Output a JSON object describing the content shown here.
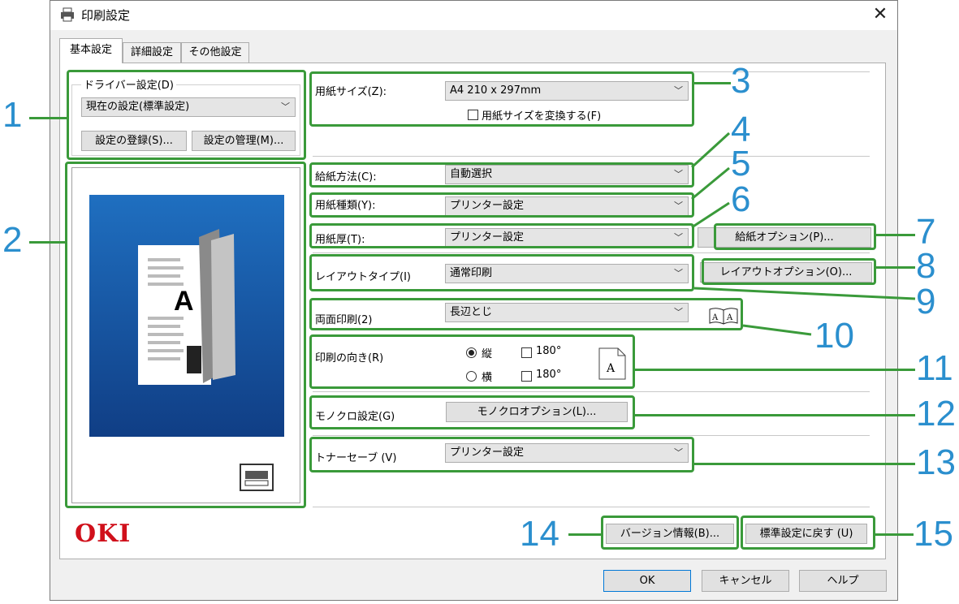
{
  "window": {
    "title": "印刷設定",
    "close_glyph": "✕"
  },
  "tabs": [
    {
      "label": "基本設定",
      "active": true
    },
    {
      "label": "詳細設定",
      "active": false
    },
    {
      "label": "その他設定",
      "active": false
    }
  ],
  "driver_settings": {
    "group_label": "ドライバー設定(D)",
    "current_value": "現在の設定(標準設定)",
    "register_button": "設定の登録(S)...",
    "manage_button": "設定の管理(M)..."
  },
  "paper_size": {
    "label": "用紙サイズ(Z):",
    "value": "A4 210 x 297mm",
    "convert_checkbox": "用紙サイズを変換する(F)",
    "convert_checked": false
  },
  "paper_source": {
    "label": "給紙方法(C):",
    "value": "自動選択"
  },
  "media_type": {
    "label": "用紙種類(Y):",
    "value": "プリンター設定"
  },
  "media_weight": {
    "label": "用紙厚(T):",
    "value": "プリンター設定"
  },
  "feed_options_button": "給紙オプション(P)...",
  "layout": {
    "label": "レイアウトタイプ(I)",
    "value": "通常印刷",
    "options_button": "レイアウトオプション(O)..."
  },
  "duplex": {
    "label": "両面印刷(2)",
    "value": "長辺とじ"
  },
  "orientation": {
    "label": "印刷の向き(R)",
    "portrait": "縦",
    "landscape": "横",
    "portrait_selected": true,
    "rotate_portrait": "180°",
    "rotate_landscape": "180°"
  },
  "mono": {
    "label": "モノクロ設定(G)",
    "button": "モノクロオプション(L)..."
  },
  "toner_save": {
    "label": "トナーセーブ (V)",
    "value": "プリンター設定"
  },
  "version_button": "バージョン情報(B)...",
  "reset_button": "標準設定に戻す (U)",
  "brand_logo": "OKI",
  "footer": {
    "ok": "OK",
    "cancel": "キャンセル",
    "help": "ヘルプ"
  },
  "callouts": [
    "1",
    "2",
    "3",
    "4",
    "5",
    "6",
    "7",
    "8",
    "9",
    "10",
    "11",
    "12",
    "13",
    "14",
    "15"
  ],
  "colors": {
    "callout_blue": "#2b8fce",
    "highlight_green": "#3a9a3a",
    "oki_red": "#d0101b",
    "preview_blue": "#1a5fa8"
  },
  "icons": [
    "printer-icon",
    "close-icon",
    "chevron-down-icon",
    "duplex-book-icon",
    "portrait-page-icon",
    "printer-status-icon"
  ]
}
